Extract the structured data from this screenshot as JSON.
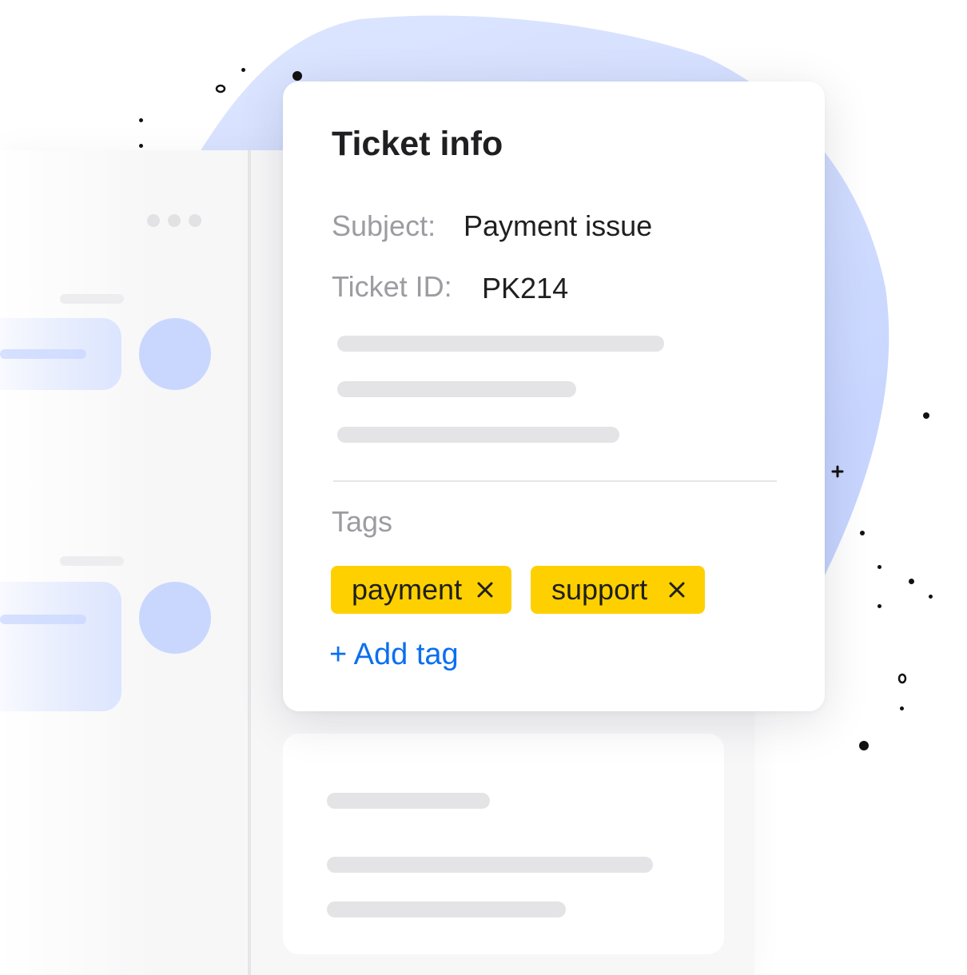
{
  "ticket": {
    "title": "Ticket info",
    "subject_label": "Subject:",
    "subject_value": "Payment issue",
    "id_label": "Ticket ID:",
    "id_value": "PK214",
    "tags_label": "Tags",
    "tags": [
      {
        "label": "payment",
        "remove_icon": "close-icon"
      },
      {
        "label": "support",
        "remove_icon": "close-icon"
      }
    ],
    "add_tag_label": "+ Add tag"
  },
  "colors": {
    "accent_blob": "#d7e1ff",
    "tag_background": "#ffd000",
    "link": "#0b6ff0",
    "avatar": "#c9d7ff"
  }
}
